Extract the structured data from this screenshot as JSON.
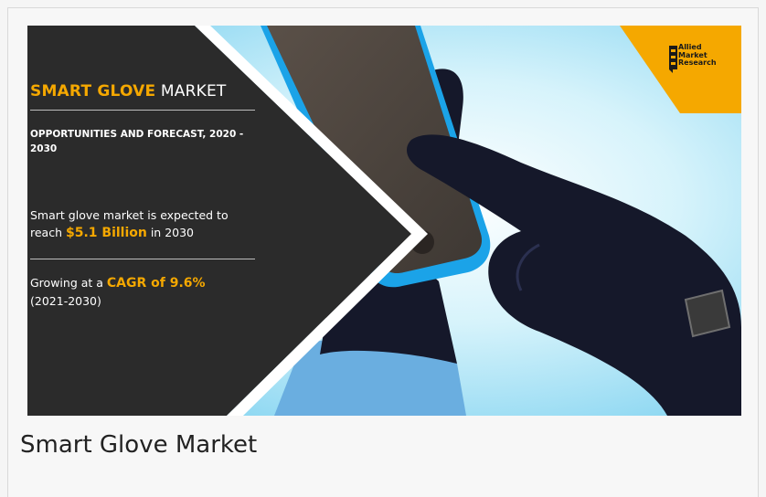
{
  "banner": {
    "title_highlight": "SMART GLOVE",
    "title_rest": " MARKET",
    "subtitle": "OPPORTUNITIES AND FORECAST, 2020 - 2030",
    "stat1_prefix": "Smart glove market is expected to reach ",
    "stat1_value": "$5.1 Billion",
    "stat1_suffix": " in 2030",
    "stat2_prefix": "Growing at a ",
    "stat2_value": "CAGR of 9.6%",
    "stat2_suffix": "(2021-2030)",
    "logo_lines": [
      "Allied",
      "Market",
      "Research"
    ]
  },
  "caption": "Smart Glove Market",
  "colors": {
    "panel": "#2b2b2b",
    "accent": "#f5a800",
    "sky": "#bfe9f7",
    "glove": "#15182a",
    "phone_edge": "#1ba3e8",
    "sleeve": "#6aaee0"
  }
}
